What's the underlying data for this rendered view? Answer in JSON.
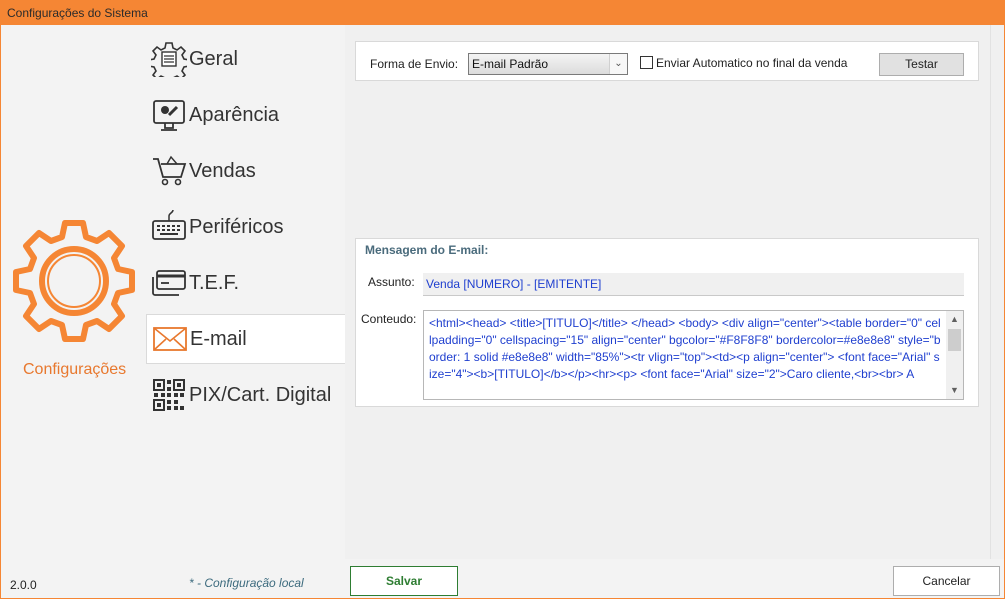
{
  "window": {
    "title": "Configurações do Sistema"
  },
  "sidebar": {
    "brand": "Configurações",
    "items": [
      {
        "label": "Geral",
        "icon": "gear-doc-icon"
      },
      {
        "label": "Aparência",
        "icon": "monitor-paint-icon"
      },
      {
        "label": "Vendas",
        "icon": "shopping-cart-icon"
      },
      {
        "label": "Periféricos",
        "icon": "keyboard-icon"
      },
      {
        "label": "T.E.F.",
        "icon": "credit-card-icon"
      },
      {
        "label": "E-mail",
        "icon": "envelope-icon",
        "active": true
      },
      {
        "label": "PIX/Cart. Digital",
        "icon": "qr-code-icon"
      }
    ]
  },
  "email": {
    "forma_label": "Forma de Envio:",
    "forma_value": "E-mail Padrão",
    "auto_label": "Enviar Automatico no final da venda",
    "auto_checked": false,
    "test_button": "Testar",
    "msg_title": "Mensagem do E-mail:",
    "assunto_label": "Assunto:",
    "assunto_value": "Venda [NUMERO] - [EMITENTE]",
    "conteudo_label": "Conteudo:",
    "conteudo_value": "<html><head> <title>[TITULO]</title> </head> <body> <div align=\"center\"><table border=\"0\" cellpadding=\"0\" cellspacing=\"15\" align=\"center\" bgcolor=\"#F8F8F8\" bordercolor=#e8e8e8\" style=\"border: 1 solid #e8e8e8\" width=\"85%\"><tr vlign=\"top\"><td><p align=\"center\"> <font face=\"Arial\" size=\"4\"><b>[TITULO]</b></p><hr><p> <font face=\"Arial\" size=\"2\">Caro cliente,<br><br> A"
  },
  "footer": {
    "version": "2.0.0",
    "note": "* - Configuração local",
    "save": "Salvar",
    "cancel": "Cancelar"
  },
  "colors": {
    "accent": "#f58634",
    "save_border": "#2e7d32",
    "link_text": "#1f3fcf"
  }
}
